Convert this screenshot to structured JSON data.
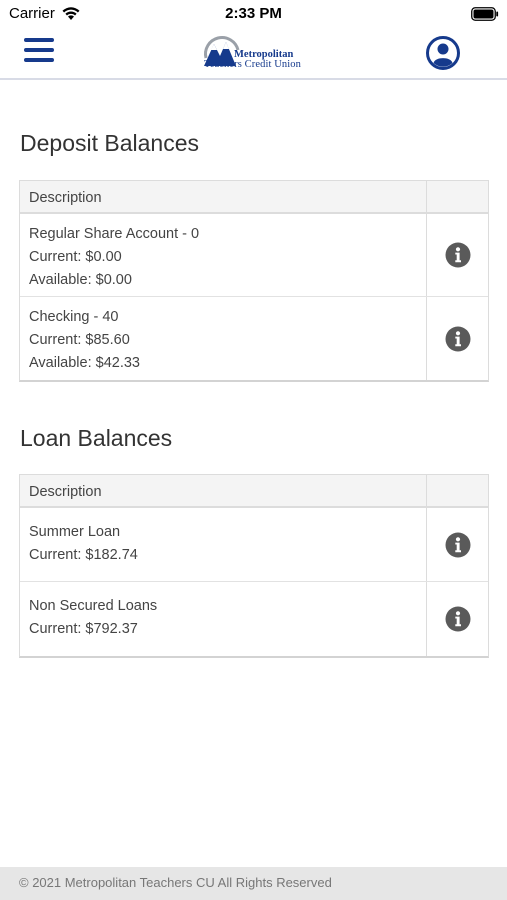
{
  "status_bar": {
    "carrier": "Carrier",
    "time": "2:33 PM",
    "wifi_icon": "wifi-icon",
    "battery_icon": "battery-icon"
  },
  "header": {
    "menu_icon": "hamburger-menu-icon",
    "logo": {
      "line1": "Metropolitan",
      "line2": "Teachers Credit Union"
    },
    "profile_icon": "user-profile-icon"
  },
  "deposits": {
    "title": "Deposit Balances",
    "column_header": "Description",
    "rows": [
      {
        "name": "Regular Share Account - 0",
        "current": "Current: $0.00",
        "available": "Available: $0.00"
      },
      {
        "name": "Checking - 40",
        "current": "Current: $85.60",
        "available": "Available: $42.33"
      }
    ]
  },
  "loans": {
    "title": "Loan Balances",
    "column_header": "Description",
    "rows": [
      {
        "name": "Summer Loan",
        "current": "Current: $182.74"
      },
      {
        "name": "Non Secured Loans",
        "current": "Current: $792.37"
      }
    ]
  },
  "footer": {
    "text": "© 2021 Metropolitan Teachers CU All Rights Reserved"
  },
  "colors": {
    "brand_blue": "#163a8c",
    "info_icon": "#5a5a5a",
    "header_bg": "#f4f4f4",
    "footer_bg": "#e6e6e6"
  }
}
